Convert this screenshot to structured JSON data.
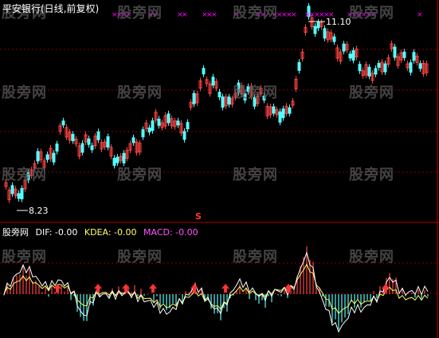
{
  "stock_title": "平安银行(日线,前复权)",
  "price_high_label": "11.10",
  "price_low_label": "8.23",
  "event_marker": "S",
  "indicator": {
    "name": "股旁网",
    "dif_label": "DIF: -0.00",
    "kdea_label": "KDEA: -0.00",
    "macd_label": "MACD: -0.00"
  },
  "watermark": "股旁网",
  "colors": {
    "up": "#ff4444",
    "down": "#54fcfc",
    "grid": "#8b0000",
    "signal_x": "#ff00ff",
    "dif_line": "#ffffff",
    "dea_line": "#ffff66",
    "macd_text": "#ff55ff",
    "arrow": "#ff3333"
  }
}
